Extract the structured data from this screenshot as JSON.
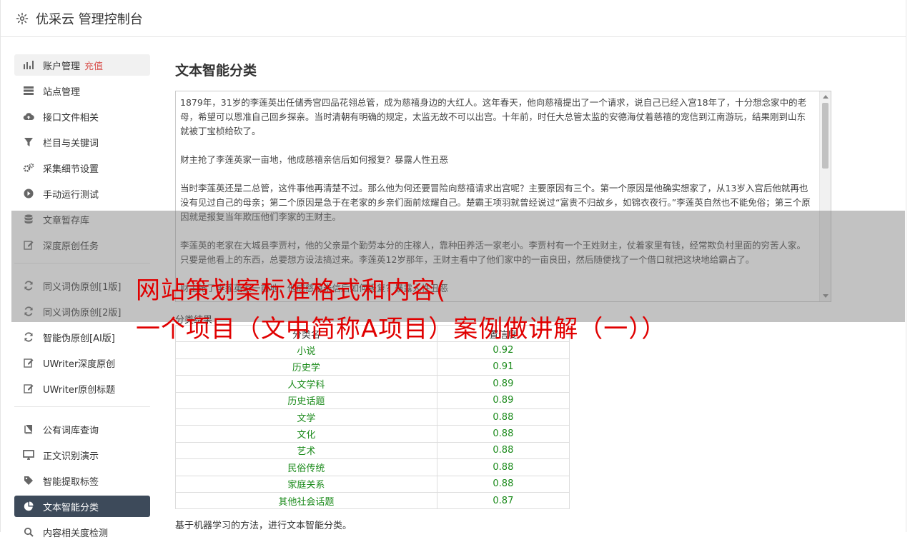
{
  "header": {
    "title": "优采云 管理控制台"
  },
  "sidebar": {
    "group1": [
      {
        "label": "账户管理",
        "badge": "充值",
        "icon": "bar-chart-icon"
      },
      {
        "label": "站点管理",
        "icon": "server-icon"
      },
      {
        "label": "接口文件相关",
        "icon": "cloud-upload-icon"
      },
      {
        "label": "栏目与关键词",
        "icon": "filter-icon"
      },
      {
        "label": "采集细节设置",
        "icon": "gears-icon"
      },
      {
        "label": "手动运行测试",
        "icon": "play-circle-icon"
      },
      {
        "label": "文章暂存库",
        "icon": "database-icon"
      },
      {
        "label": "深度原创任务",
        "icon": "edit-icon"
      }
    ],
    "group2": [
      {
        "label": "同义词伪原创[1版]",
        "icon": "refresh-icon"
      },
      {
        "label": "同义词伪原创[2版]",
        "icon": "refresh-icon"
      },
      {
        "label": "智能伪原创[AI版]",
        "icon": "refresh-icon"
      },
      {
        "label": "UWriter深度原创",
        "icon": "edit-icon"
      },
      {
        "label": "UWriter原创标题",
        "icon": "edit-icon"
      }
    ],
    "group3": [
      {
        "label": "公有词库查询",
        "icon": "book-icon"
      },
      {
        "label": "正文识别演示",
        "icon": "monitor-icon"
      },
      {
        "label": "智能提取标签",
        "icon": "tag-icon"
      },
      {
        "label": "文本智能分类",
        "icon": "pie-chart-icon"
      },
      {
        "label": "内容相关度检测",
        "icon": "search-icon"
      }
    ]
  },
  "main": {
    "title": "文本智能分类",
    "text": [
      "1879年，31岁的李莲英出任储秀宫四品花翎总管，成为慈禧身边的大红人。这年春天，他向慈禧提出了一个请求，说自己已经入宫18年了，十分想念家中的老母，希望可以恩准自己回乡探亲。当时清朝有明确的规定，太监无故不可以出宫。十年前，时任大总管太监的安德海仗着慈禧的宠信到江南游玩，结果刚到山东就被丁宝桢给砍了。",
      "财主抢了李莲英家一亩地，他成慈禧亲信后如何报复？暴露人性丑恶",
      "当时李莲英还是二总管，这件事他再清楚不过。那么他为何还要冒险向慈禧请求出宫呢？主要原因有三个。第一个原因是他确实想家了，从13岁入宫后他就再也没有见过自己的母亲；第二个原因是急于在老家的乡亲们面前炫耀自己。楚霸王项羽就曾经说过“富贵不归故乡，如锦衣夜行。”李莲英自然也不能免俗；第三个原因就是报复当年欺压他们李家的王财主。",
      "李莲英的老家在大城县李贾村，他的父亲是个勤劳本分的庄稼人，靠种田养活一家老小。李贾村有一个王姓财主，仗着家里有钱，经常欺负村里面的穷苦人家。只要是他看上的东西，总要想方设法搞过来。李莲英12岁那年，王财主看中了他们家中的一亩良田，然后随便找了一个借口就把这块地给霸占了。",
      "财主抢了李莲英家一亩地，他成慈禧亲信后如何报复？暴露人性丑恶"
    ],
    "result_label": "分类结果",
    "table": {
      "headers": [
        "分类名",
        "置信度"
      ],
      "rows": [
        [
          "小说",
          "0.92"
        ],
        [
          "历史学",
          "0.91"
        ],
        [
          "人文学科",
          "0.89"
        ],
        [
          "历史话题",
          "0.89"
        ],
        [
          "文学",
          "0.88"
        ],
        [
          "文化",
          "0.88"
        ],
        [
          "艺术",
          "0.88"
        ],
        [
          "民俗传统",
          "0.88"
        ],
        [
          "家庭关系",
          "0.88"
        ],
        [
          "其他社会话题",
          "0.87"
        ]
      ]
    },
    "footnote": "基于机器学习的方法，进行文本智能分类。"
  },
  "overlay": {
    "line1": "网站策划案标准格式和内容(",
    "line2": "一个项目（文中简称A项目）案例做讲解（一））"
  },
  "colors": {
    "active_bg": "#3d4a5a",
    "badge": "#d9534f",
    "value": "#1a8a1a",
    "overlay_text": "#e00000"
  }
}
